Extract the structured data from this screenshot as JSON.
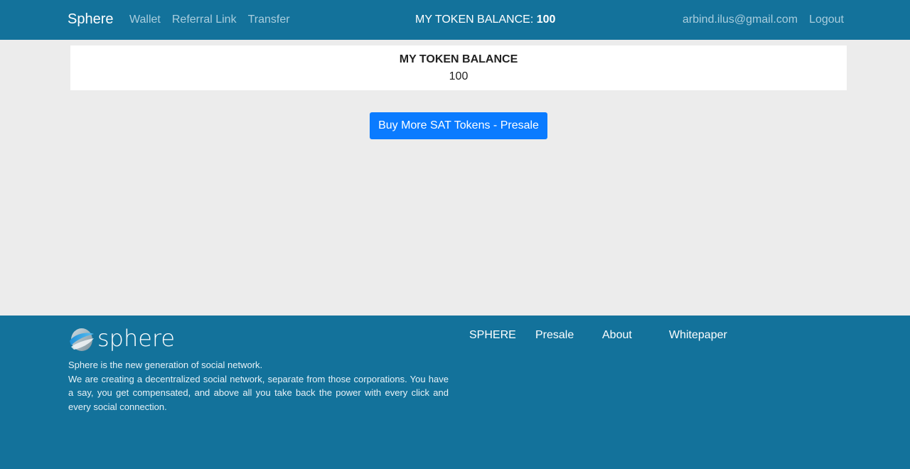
{
  "navbar": {
    "brand": "Sphere",
    "links": [
      "Wallet",
      "Referral Link",
      "Transfer"
    ],
    "balance_label": "MY TOKEN BALANCE:",
    "balance_value": "100",
    "email": "arbind.ilus@gmail.com",
    "logout": "Logout"
  },
  "balance_card": {
    "title": "MY TOKEN BALANCE",
    "value": "100"
  },
  "buy_button": "Buy More SAT Tokens - Presale",
  "footer": {
    "logo_text": "sphere",
    "line1": "Sphere is the new generation of social network.",
    "line2": "We are creating a decentralized social network, separate from those corporations. You have a say, you get compensated, and above all you take back the power with every click and every social connection.",
    "links": [
      "SPHERE",
      "Presale",
      "About",
      "Whitepaper"
    ]
  },
  "colors": {
    "navbar_bg": "#13729b",
    "button_bg": "#0a7bff",
    "page_bg": "#ececec"
  }
}
